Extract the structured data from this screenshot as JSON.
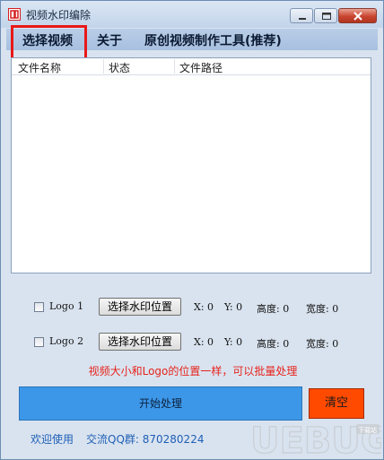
{
  "window": {
    "title": "视频水印编除",
    "buttons": {
      "minimize": "minimize-icon",
      "maximize": "maximize-icon",
      "close": "close-icon"
    }
  },
  "menu": {
    "items": [
      {
        "label": "选择视频"
      },
      {
        "label": "关于"
      },
      {
        "label": "原创视频制作工具(推荐)"
      }
    ]
  },
  "list": {
    "columns": [
      "文件名称",
      "状态",
      "文件路径"
    ],
    "rows": []
  },
  "logo_rows": [
    {
      "checkbox_label": "Logo 1",
      "checked": false,
      "button_label": "选择水印位置",
      "x_label": "X: 0",
      "y_label": "Y: 0",
      "height_label": "高度: 0",
      "width_label": "宽度: 0"
    },
    {
      "checkbox_label": "Logo 2",
      "checked": false,
      "button_label": "选择水印位置",
      "x_label": "X: 0",
      "y_label": "Y: 0",
      "height_label": "高度: 0",
      "width_label": "宽度: 0"
    }
  ],
  "note": "视频大小和Logo的位置一样，可以批量处理",
  "actions": {
    "start_label": "开始处理",
    "clear_label": "清空"
  },
  "footer": {
    "welcome": "欢迎使用",
    "qq_group": "交流QQ群: 870280224"
  },
  "watermark": {
    "text": "UEBUG",
    "badge": "下载站"
  },
  "colors": {
    "start_button": "#3d97e8",
    "clear_button": "#ff4a00",
    "note_text": "#e6231c",
    "highlight_box": "#e81818",
    "footer_text": "#1f5fb6"
  }
}
